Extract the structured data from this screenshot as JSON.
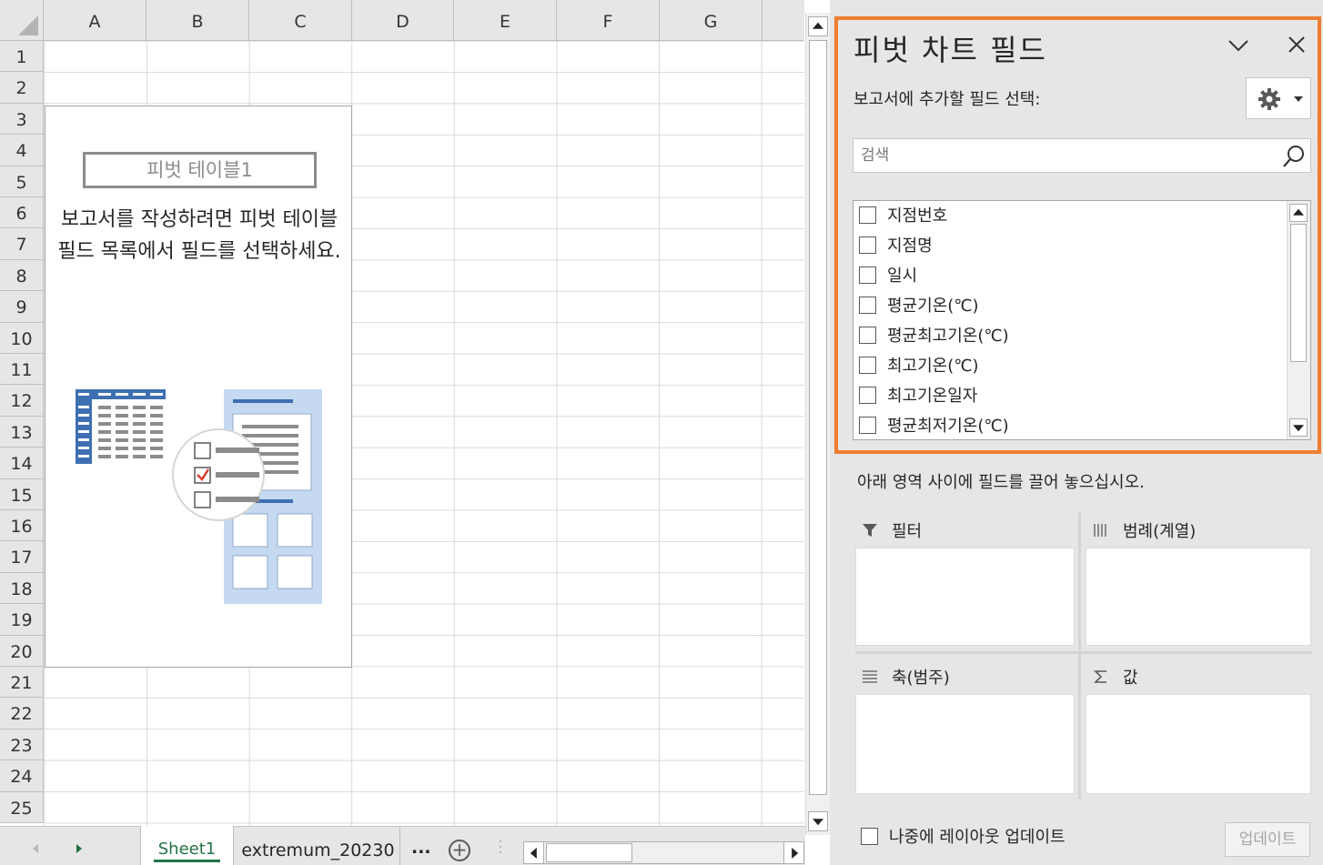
{
  "sheet": {
    "columns": [
      "A",
      "B",
      "C",
      "D",
      "E",
      "F",
      "G"
    ],
    "rows": [
      "1",
      "2",
      "3",
      "4",
      "5",
      "6",
      "7",
      "8",
      "9",
      "10",
      "11",
      "12",
      "13",
      "14",
      "15",
      "16",
      "17",
      "18",
      "19",
      "20",
      "21",
      "22",
      "23",
      "24",
      "25"
    ]
  },
  "pivot_placeholder": {
    "name": "피벗 테이블1",
    "message": "보고서를 작성하려면 피벗 테이블 필드 목록에서 필드를 선택하세요."
  },
  "tabs": {
    "sheet1": "Sheet1",
    "extremum": "extremum_20230",
    "more": "...",
    "add": "+"
  },
  "pane": {
    "title": "피벗 차트 필드",
    "choose_label": "보고서에 추가할 필드 선택:",
    "search_placeholder": "검색",
    "fields": [
      "지점번호",
      "지점명",
      "일시",
      "평균기온(℃)",
      "평균최고기온(℃)",
      "최고기온(℃)",
      "최고기온일자",
      "평균최저기온(℃)"
    ],
    "drag_hint": "아래 영역 사이에 필드를 끌어 놓으십시오.",
    "areas": {
      "filter": "필터",
      "legend": "범례(계열)",
      "axis": "축(범주)",
      "values": "값"
    },
    "defer_label": "나중에 레이아웃 업데이트",
    "update_label": "업데이트"
  },
  "colors": {
    "highlight": "#ed7d31",
    "active_tab": "#217346",
    "pane_bg": "#e6e6e6"
  },
  "icons": [
    "chevron-down-icon",
    "close-icon",
    "gear-icon",
    "search-icon",
    "filter-icon",
    "columns-icon",
    "rows-icon",
    "sigma-icon",
    "add-sheet-icon"
  ]
}
